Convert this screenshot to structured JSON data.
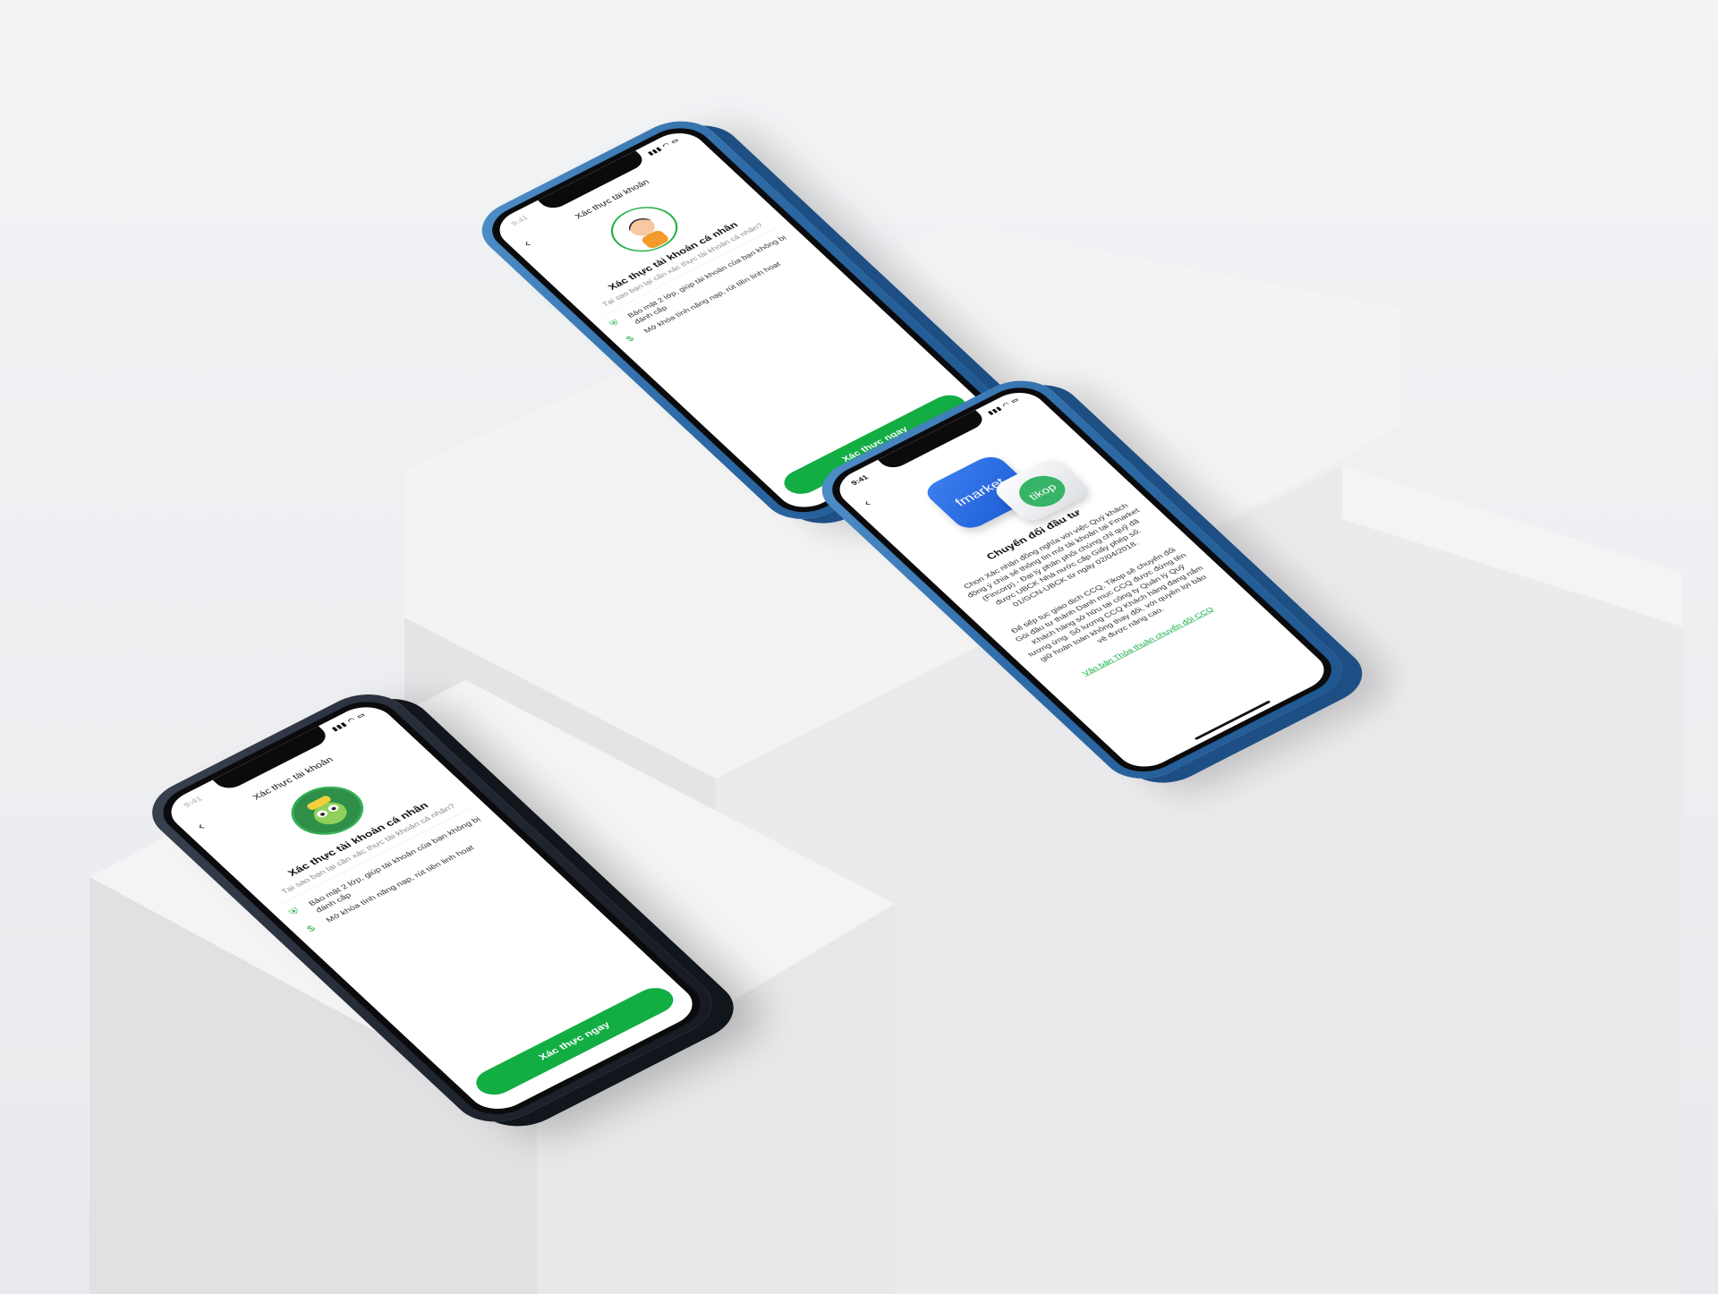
{
  "scene": {
    "background": "#eeeff1",
    "accent_green": "#12ad43",
    "phone_colors": {
      "blue": "#2f6ea8",
      "dark": "#1c212b"
    }
  },
  "phones": [
    {
      "id": "top-blue",
      "time": "9:41",
      "nav_title": "Xác thực tài khoản",
      "heading": "Xác thực tài khoản cá nhân",
      "subtitle": "Tại sao bạn lại cần xác thực tài khoản cá nhân?",
      "benefits": [
        {
          "icon": "shield-icon",
          "text": "Bảo mật 2 lớp, giúp tài khoản của bạn không bị đánh cắp"
        },
        {
          "icon": "money-icon",
          "text": "Mở khóa tính năng nạp, rút tiền linh hoạt"
        }
      ],
      "cta": "Xác thực ngay"
    },
    {
      "id": "right-blue",
      "time": "9:41",
      "heading": "Chuyển đổi đầu tư",
      "logo_fmarket": "fmarket",
      "logo_tikop": "tikop",
      "paragraph1": "Chọn Xác nhận đồng nghĩa với việc Quý khách đồng ý chia sẻ thông tin mở tài khoản tại Fmarket (Fincorp) - Đại lý phân phối chứng chỉ quỹ đã được UBCK Nhà nước cấp Giấy phép số: 01/GCN-UBCK từ ngày 02/04/2018.",
      "paragraph2": "Để tiếp tục giao dịch CCQ, Tikop sẽ chuyển đổi Gói đầu tư thành Danh mục CCQ được đứng tên Khách hàng sở hữu tại công ty Quản lý Quỹ tương ứng. Số lượng CCQ Khách hàng đang nắm giữ hoàn toàn không thay đổi, với quyền lợi bảo vệ được nâng cao.",
      "link": "Văn bản Thỏa thuận chuyển đổi CCQ"
    },
    {
      "id": "bottom-dark",
      "time": "9:41",
      "nav_title": "Xác thực tài khoản",
      "heading": "Xác thực tài khoản cá nhân",
      "subtitle": "Tại sao bạn lại cần xác thực tài khoản cá nhân?",
      "benefits": [
        {
          "icon": "shield-icon",
          "text": "Bảo mật 2 lớp, giúp tài khoản của bạn không bị đánh cắp"
        },
        {
          "icon": "money-icon",
          "text": "Mở khóa tính năng nạp, rút tiền linh hoạt"
        }
      ],
      "cta": "Xác thực ngay"
    }
  ]
}
